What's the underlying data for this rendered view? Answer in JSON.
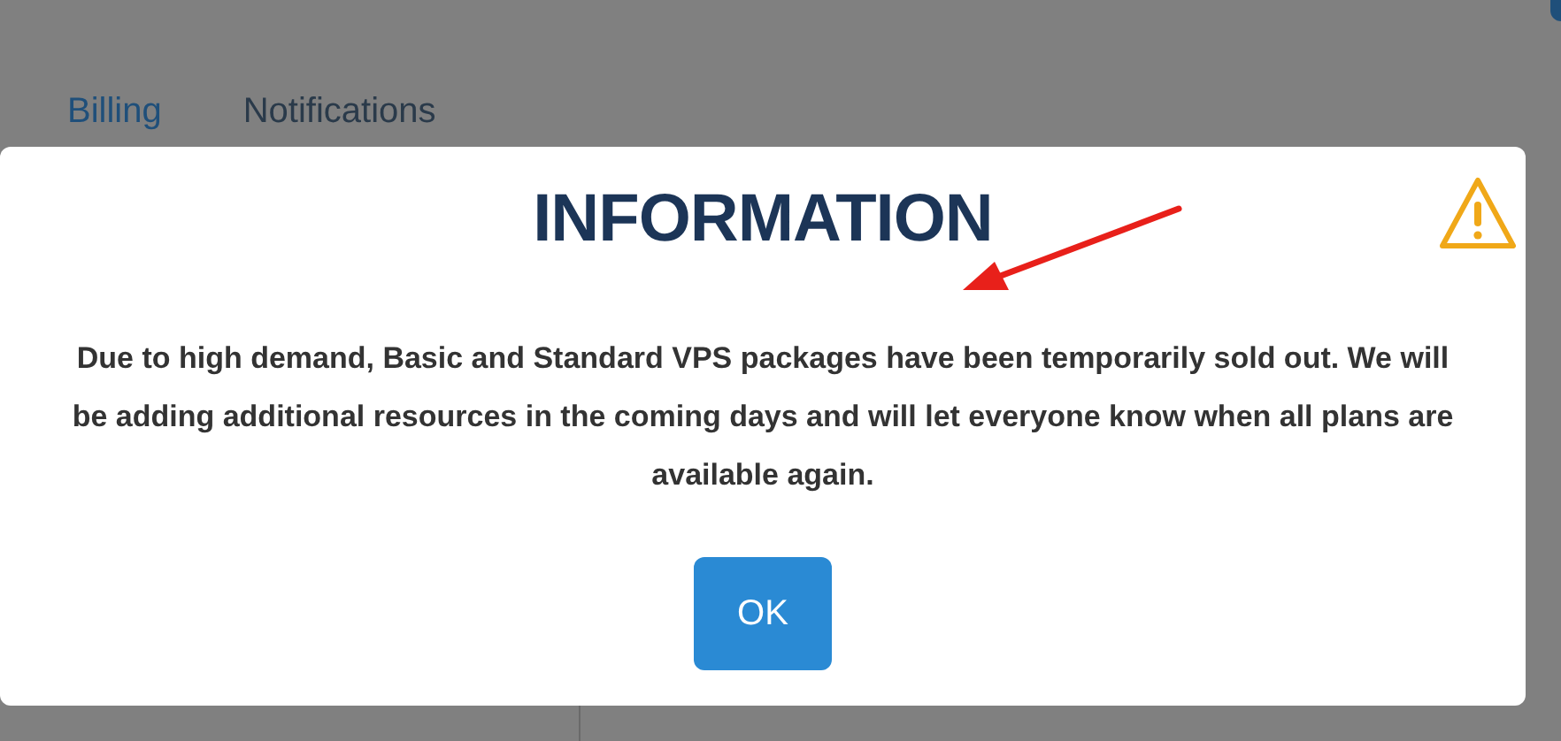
{
  "tabs": [
    {
      "label": "Billing",
      "selected": true
    },
    {
      "label": "Notifications",
      "selected": false
    }
  ],
  "dialog": {
    "title": "INFORMATION",
    "message": "Due to high demand, Basic and Standard VPS packages have been temporarily sold out. We will be adding additional resources in the coming days and will let everyone know when all plans are available again.",
    "button": "OK"
  },
  "annotation": {
    "kind": "arrow"
  }
}
